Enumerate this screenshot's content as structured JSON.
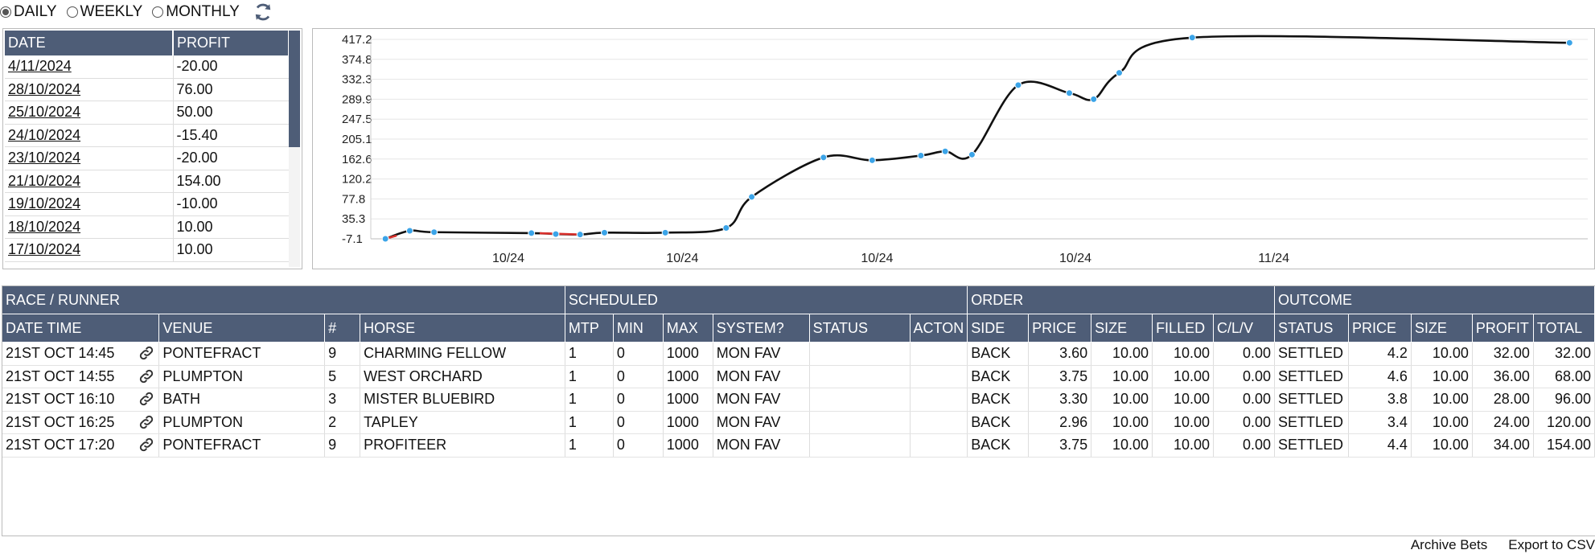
{
  "period": {
    "options": [
      {
        "label": "DAILY",
        "selected": true
      },
      {
        "label": "WEEKLY",
        "selected": false
      },
      {
        "label": "MONTHLY",
        "selected": false
      }
    ],
    "refresh_icon": "refresh-icon"
  },
  "daily": {
    "headers": {
      "date": "DATE",
      "profit": "PROFIT"
    },
    "rows": [
      {
        "date": "4/11/2024",
        "profit": "-20.00"
      },
      {
        "date": "28/10/2024",
        "profit": "76.00"
      },
      {
        "date": "25/10/2024",
        "profit": "50.00"
      },
      {
        "date": "24/10/2024",
        "profit": "-15.40"
      },
      {
        "date": "23/10/2024",
        "profit": "-20.00"
      },
      {
        "date": "21/10/2024",
        "profit": "154.00"
      },
      {
        "date": "19/10/2024",
        "profit": "-10.00"
      },
      {
        "date": "18/10/2024",
        "profit": "10.00"
      },
      {
        "date": "17/10/2024",
        "profit": "10.00"
      }
    ]
  },
  "chart_data": {
    "type": "line",
    "yticks": [
      "417.2",
      "374.8",
      "332.3",
      "289.9",
      "247.5",
      "205.1",
      "162.6",
      "120.2",
      "77.8",
      "35.3",
      "-7.1"
    ],
    "ylim": [
      -7.1,
      417.2
    ],
    "xticks": [
      "10/24",
      "10/24",
      "10/24",
      "10/24",
      "11/24"
    ],
    "points": [
      -7.1,
      10,
      7,
      5,
      3,
      2,
      6,
      6,
      16,
      82,
      166,
      160,
      170,
      179,
      172,
      320,
      303,
      290,
      346,
      421,
      410
    ],
    "line_color": "#111111",
    "negative_color": "#d9302c",
    "point_color": "#3ba4e8",
    "grid": true
  },
  "bets": {
    "groups": [
      "RACE / RUNNER",
      "SCHEDULED",
      "ORDER",
      "OUTCOME"
    ],
    "columns": [
      "DATE TIME",
      "VENUE",
      "#",
      "HORSE",
      "MTP",
      "MIN",
      "MAX",
      "SYSTEM?",
      "STATUS",
      "ACTON",
      "SIDE",
      "PRICE",
      "SIZE",
      "FILLED",
      "C/L/V",
      "STATUS",
      "PRICE",
      "SIZE",
      "PROFIT",
      "TOTAL"
    ],
    "rows": [
      {
        "datetime": "21ST OCT 14:45",
        "venue": "PONTEFRACT",
        "num": "9",
        "horse": "CHARMING FELLOW",
        "mtp": "1",
        "min": "0",
        "max": "1000",
        "system": "MON FAV",
        "status": "",
        "action": "",
        "side": "BACK",
        "price": "3.60",
        "size": "10.00",
        "filled": "10.00",
        "clv": "0.00",
        "out_status": "SETTLED",
        "out_price": "4.2",
        "out_size": "10.00",
        "profit": "32.00",
        "total": "32.00"
      },
      {
        "datetime": "21ST OCT 14:55",
        "venue": "PLUMPTON",
        "num": "5",
        "horse": "WEST ORCHARD",
        "mtp": "1",
        "min": "0",
        "max": "1000",
        "system": "MON FAV",
        "status": "",
        "action": "",
        "side": "BACK",
        "price": "3.75",
        "size": "10.00",
        "filled": "10.00",
        "clv": "0.00",
        "out_status": "SETTLED",
        "out_price": "4.6",
        "out_size": "10.00",
        "profit": "36.00",
        "total": "68.00"
      },
      {
        "datetime": "21ST OCT 16:10",
        "venue": "BATH",
        "num": "3",
        "horse": "MISTER BLUEBIRD",
        "mtp": "1",
        "min": "0",
        "max": "1000",
        "system": "MON FAV",
        "status": "",
        "action": "",
        "side": "BACK",
        "price": "3.30",
        "size": "10.00",
        "filled": "10.00",
        "clv": "0.00",
        "out_status": "SETTLED",
        "out_price": "3.8",
        "out_size": "10.00",
        "profit": "28.00",
        "total": "96.00"
      },
      {
        "datetime": "21ST OCT 16:25",
        "venue": "PLUMPTON",
        "num": "2",
        "horse": "TAPLEY",
        "mtp": "1",
        "min": "0",
        "max": "1000",
        "system": "MON FAV",
        "status": "",
        "action": "",
        "side": "BACK",
        "price": "2.96",
        "size": "10.00",
        "filled": "10.00",
        "clv": "0.00",
        "out_status": "SETTLED",
        "out_price": "3.4",
        "out_size": "10.00",
        "profit": "24.00",
        "total": "120.00"
      },
      {
        "datetime": "21ST OCT 17:20",
        "venue": "PONTEFRACT",
        "num": "9",
        "horse": "PROFITEER",
        "mtp": "1",
        "min": "0",
        "max": "1000",
        "system": "MON FAV",
        "status": "",
        "action": "",
        "side": "BACK",
        "price": "3.75",
        "size": "10.00",
        "filled": "10.00",
        "clv": "0.00",
        "out_status": "SETTLED",
        "out_price": "4.4",
        "out_size": "10.00",
        "profit": "34.00",
        "total": "154.00"
      }
    ]
  },
  "footer": {
    "archive": "Archive Bets",
    "export": "Export to CSV"
  },
  "colors": {
    "header_bg": "#4e5d77",
    "header_text": "#ffffff"
  }
}
